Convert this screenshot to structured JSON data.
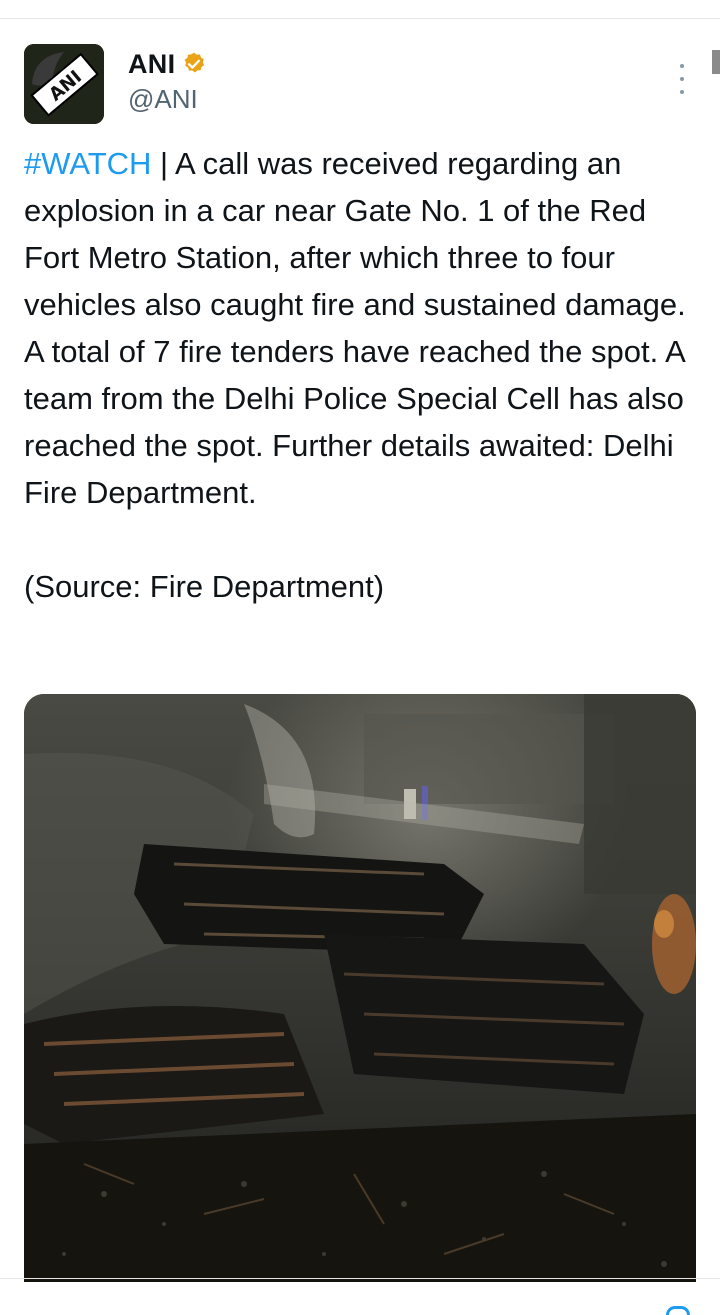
{
  "author": {
    "display_name": "ANI",
    "handle": "@ANI",
    "verified": true,
    "avatar_text": "ANI",
    "avatar_icon": "ani-logo"
  },
  "menu": {
    "icon": "more-vertical-icon"
  },
  "tweet": {
    "hashtag": "#WATCH",
    "body": " | A call was received regarding an explosion in a car near Gate No. 1 of the Red Fort Metro Station, after which three to four vehicles also caught fire and sustained damage. A total of 7 fire tenders have reached the spot. A team from the Delhi Police Special Cell has also reached the spot. Further details awaited: Delhi Fire Department.\n\n(Source: Fire Department)"
  },
  "media": {
    "kind": "video-still",
    "icon": "burnt-vehicles-image"
  },
  "colors": {
    "link": "#1d9bf0",
    "verified_badge": "#e8a317",
    "text": "#0f1419",
    "secondary_text": "#536471"
  }
}
